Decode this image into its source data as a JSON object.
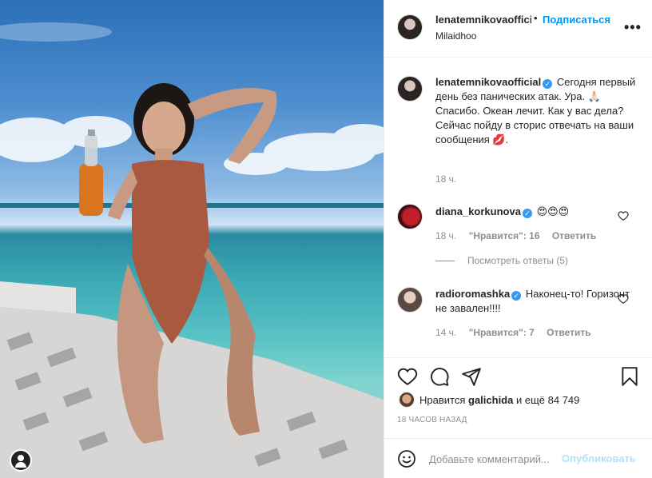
{
  "header": {
    "username": "lenatemnikovaofficial",
    "dot": "•",
    "follow_label": "Подписаться",
    "location": "Milaidhoo",
    "more_label": "•••"
  },
  "caption": {
    "username": "lenatemnikovaofficial",
    "verified": "✓",
    "text": "Сегодня первый день без панических атак. Ура. 🙏🏻Спасибо. Океан лечит. Как у вас дела? Сейчас пойду в сторис отвечать на ваши сообщения 💋.",
    "time": "18 ч."
  },
  "comments": [
    {
      "username": "diana_korkunova",
      "verified": "✓",
      "text": "😍😍😍",
      "time": "18 ч.",
      "likes": "\"Нравится\": 16",
      "reply": "Ответить"
    },
    {
      "username": "radioromashka",
      "verified": "✓",
      "text": "Наконец-то! Горизонт не завален!!!!",
      "time": "14 ч.",
      "likes": "\"Нравится\": 7",
      "reply": "Ответить"
    }
  ],
  "view_replies": "Посмотреть ответы (5)",
  "actions": {
    "likes_prefix": "Нравится",
    "liker": "galichida",
    "likes_suffix": "и ещё 84 749",
    "time_ago": "18 ЧАСОВ НАЗАД"
  },
  "add_comment": {
    "placeholder": "Добавьте комментарий...",
    "publish_label": "Опубликовать"
  },
  "icons": {
    "like": "heart-icon",
    "comment": "comment-icon",
    "share": "share-icon",
    "save": "bookmark-icon",
    "emoji": "emoji-icon",
    "profile": "profile-icon"
  },
  "colors": {
    "accent": "#0095f6",
    "verified": "#3897f0",
    "muted": "#8e8e8e",
    "publish_disabled": "#b2dffc"
  }
}
